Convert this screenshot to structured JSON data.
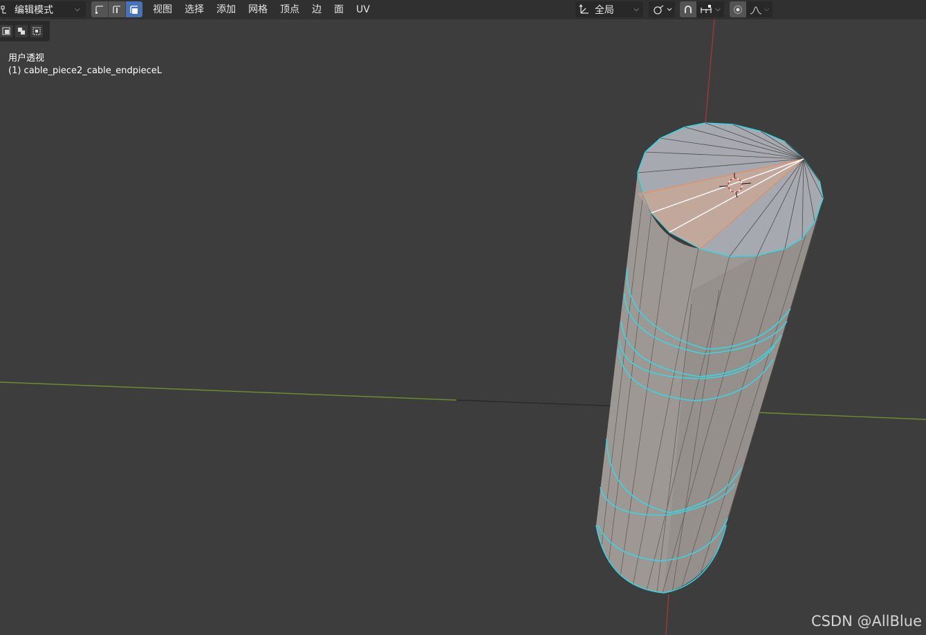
{
  "header": {
    "mode_label": "编辑模式",
    "menu": [
      "视图",
      "选择",
      "添加",
      "网格",
      "顶点",
      "边",
      "面",
      "UV"
    ],
    "orientation_label": "全局"
  },
  "viewport": {
    "view_name": "用户透视",
    "object_name": "(1) cable_piece2_cable_endpieceL"
  },
  "watermark": "CSDN @AllBlue",
  "colors": {
    "background": "#3d3d3d",
    "header": "#303030",
    "active_select": "#4772b3",
    "selection_edge": "#35d7e3",
    "selected_face": "#e88a52",
    "axis_x": "#6e8f2c",
    "axis_z": "#a13838"
  }
}
